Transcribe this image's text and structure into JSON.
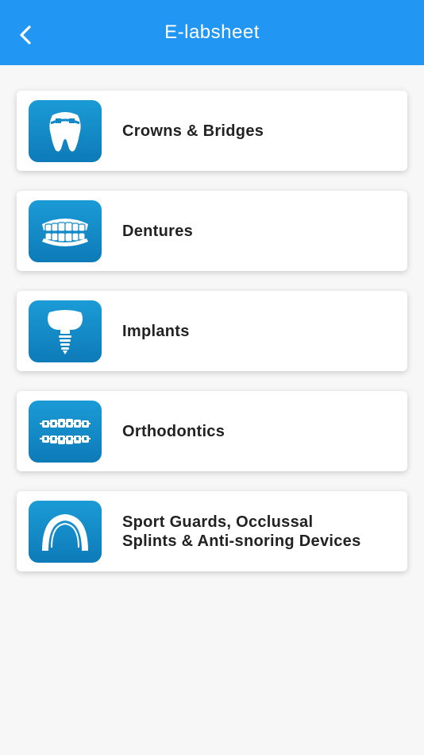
{
  "header": {
    "title": "E-labsheet",
    "back_icon": "chevron-left-icon"
  },
  "colors": {
    "header_bg": "#2196f3",
    "icon_bg": "#1189c7",
    "page_bg": "#f7f7f7"
  },
  "items": [
    {
      "label": "Crowns & Bridges",
      "icon": "tooth-crown-icon"
    },
    {
      "label": "Dentures",
      "icon": "dentures-icon"
    },
    {
      "label": "Implants",
      "icon": "dental-implant-icon"
    },
    {
      "label": "Orthodontics",
      "icon": "braces-icon"
    },
    {
      "label": "Sport Guards, Occlussal\nSplints & Anti-snoring Devices",
      "icon": "mouth-guard-icon"
    }
  ]
}
